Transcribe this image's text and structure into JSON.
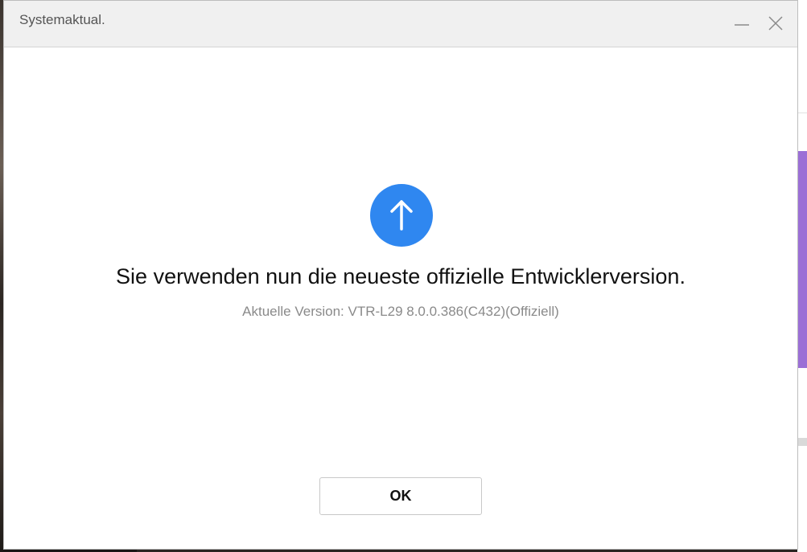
{
  "window": {
    "title": "Systemaktual."
  },
  "message": {
    "icon": "arrow-up-icon",
    "headline": "Sie verwenden nun die neueste offizielle Entwicklerversion.",
    "version_text": "Aktuelle Version: VTR-L29 8.0.0.386(C432)(Offiziell)"
  },
  "actions": {
    "ok_label": "OK"
  },
  "colors": {
    "accent": "#2f87f0",
    "titlebar": "#f0f0f0",
    "background_purple": "#9b6fd6"
  }
}
